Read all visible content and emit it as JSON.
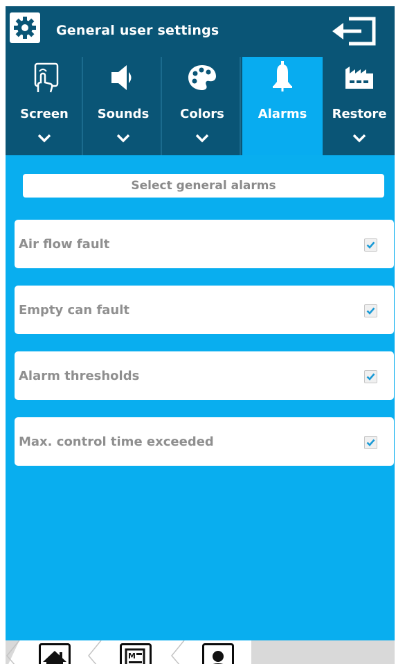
{
  "header": {
    "title": "General user settings",
    "settings_icon": "gear-icon",
    "exit_icon": "logout-arrow-icon"
  },
  "tabs": [
    {
      "label": "Screen",
      "icon": "touch-screen-icon",
      "active": false
    },
    {
      "label": "Sounds",
      "icon": "speaker-icon",
      "active": false
    },
    {
      "label": "Colors",
      "icon": "palette-icon",
      "active": false
    },
    {
      "label": "Alarms",
      "icon": "bell-icon",
      "active": true
    },
    {
      "label": "Restore",
      "icon": "factory-icon",
      "active": false
    }
  ],
  "main": {
    "section_title": "Select general alarms",
    "alarms": [
      {
        "label": "Air flow fault",
        "checked": true
      },
      {
        "label": "Empty can fault",
        "checked": true
      },
      {
        "label": "Alarm thresholds",
        "checked": true
      },
      {
        "label": "Max. control time exceeded",
        "checked": true
      }
    ]
  },
  "bottom_nav": [
    {
      "icon": "home-icon"
    },
    {
      "icon": "menu-document-icon"
    },
    {
      "icon": "user-icon"
    }
  ],
  "colors": {
    "header_bg": "#0a5576",
    "accent": "#09aeef",
    "check_color": "#1a9ad6"
  }
}
